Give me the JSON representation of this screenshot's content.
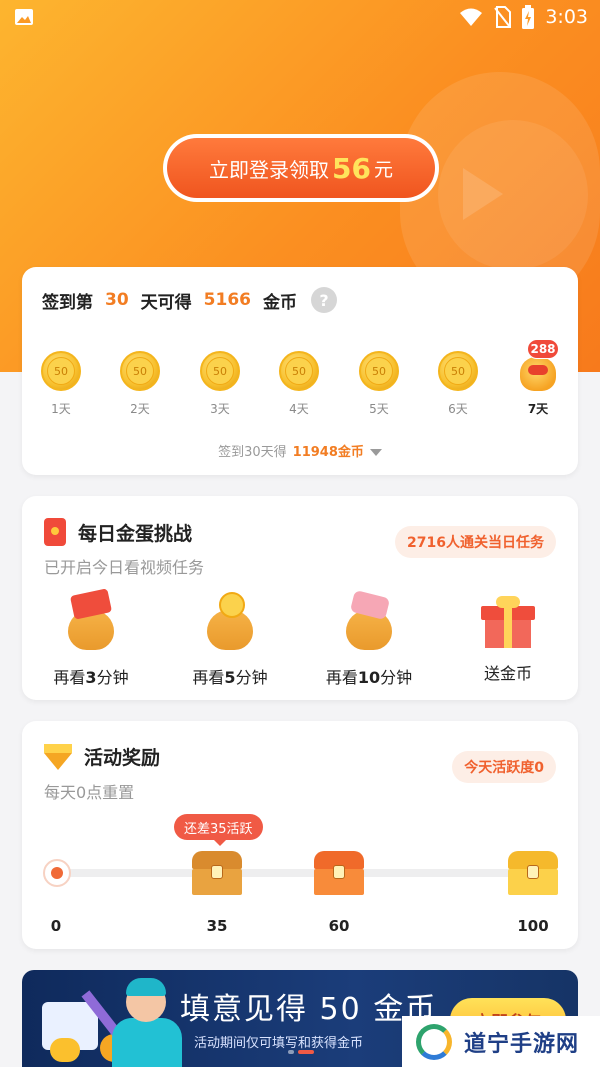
{
  "status_bar": {
    "time": "3:03"
  },
  "login": {
    "prefix": "立即登录领取",
    "amount": "56",
    "suffix": "元"
  },
  "signin": {
    "title_pre": "签到第",
    "days_num": "30",
    "title_mid": "天可得",
    "coins_num": "5166",
    "title_post": "金币",
    "help": "?",
    "days": [
      {
        "coin": "50",
        "label": "1天"
      },
      {
        "coin": "50",
        "label": "2天"
      },
      {
        "coin": "50",
        "label": "3天"
      },
      {
        "coin": "50",
        "label": "4天"
      },
      {
        "coin": "50",
        "label": "5天"
      },
      {
        "coin": "50",
        "label": "6天"
      },
      {
        "badge": "288",
        "label": "7天"
      }
    ],
    "footer_pre": "签到30天得",
    "footer_amount": "11948金币"
  },
  "egg": {
    "title": "每日金蛋挑战",
    "subtitle": "已开启今日看视频任务",
    "pill": "2716人通关当日任务",
    "items": [
      {
        "pre": "再看",
        "num": "3",
        "post": "分钟"
      },
      {
        "pre": "再看",
        "num": "5",
        "post": "分钟"
      },
      {
        "pre": "再看",
        "num": "10",
        "post": "分钟"
      },
      {
        "pre": "送金币",
        "num": "",
        "post": ""
      }
    ]
  },
  "activity": {
    "title": "活动奖励",
    "subtitle": "每天0点重置",
    "pill": "今天活跃度0",
    "tooltip": "还差35活跃",
    "current": 0,
    "milestones": [
      "0",
      "35",
      "60",
      "100"
    ]
  },
  "banner": {
    "title": "填意见得 50 金币",
    "subtitle": "活动期间仅可填写和获得金币",
    "cta": "立即参与"
  },
  "watermark": {
    "text": "道宁手游网"
  },
  "colors": {
    "accent": "#f27d23",
    "hero_start": "#fdb52f",
    "hero_end": "#f77a1c",
    "red": "#f04a3a"
  }
}
